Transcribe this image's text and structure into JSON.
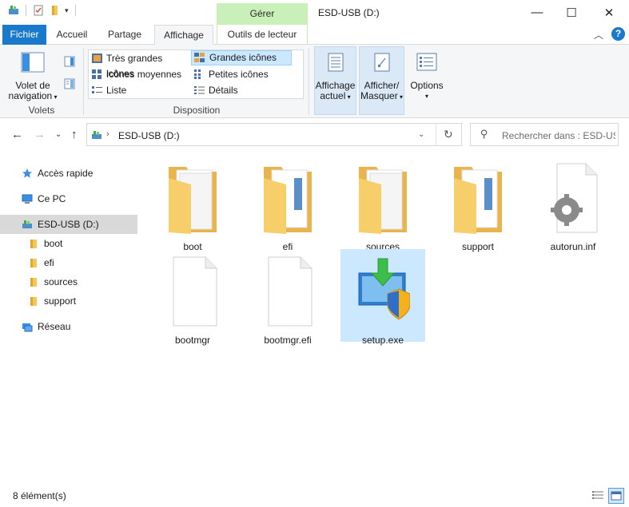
{
  "window": {
    "title": "ESD-USB (D:)",
    "contextual_group": "Gérer",
    "minimize_glyph": "—",
    "maximize_glyph": "☐",
    "close_glyph": "✕"
  },
  "tabs": {
    "file": "Fichier",
    "home": "Accueil",
    "share": "Partage",
    "view": "Affichage",
    "drive_tools": "Outils de lecteur"
  },
  "ribbon": {
    "panes": {
      "nav_pane_line1": "Volet de",
      "nav_pane_line2": "navigation",
      "group": "Volets"
    },
    "layout": {
      "group": "Disposition",
      "extra_large": "Très grandes icônes",
      "large": "Grandes icônes",
      "medium": "Icônes moyennes",
      "small": "Petites icônes",
      "list": "Liste",
      "details": "Détails"
    },
    "current_view_line1": "Affichage",
    "current_view_line2": "actuel",
    "show_hide_line1": "Afficher/",
    "show_hide_line2": "Masquer",
    "options": "Options"
  },
  "address": {
    "path": "ESD-USB (D:)",
    "search_placeholder": "Rechercher dans : ESD-US..."
  },
  "nav_pane": {
    "items": [
      {
        "label": "Accès rapide",
        "icon": "star-icon"
      },
      {
        "label": "Ce PC",
        "icon": "computer-icon"
      },
      {
        "label": "ESD-USB (D:)",
        "icon": "usb-drive-icon",
        "selected": true
      },
      {
        "label": "boot",
        "icon": "folder-icon"
      },
      {
        "label": "efi",
        "icon": "folder-icon"
      },
      {
        "label": "sources",
        "icon": "folder-icon"
      },
      {
        "label": "support",
        "icon": "folder-icon"
      },
      {
        "label": "Réseau",
        "icon": "network-icon"
      }
    ]
  },
  "files": [
    {
      "name": "boot",
      "type": "folder"
    },
    {
      "name": "efi",
      "type": "folder"
    },
    {
      "name": "sources",
      "type": "folder"
    },
    {
      "name": "support",
      "type": "folder"
    },
    {
      "name": "autorun.inf",
      "type": "settings-file"
    },
    {
      "name": "bootmgr",
      "type": "file"
    },
    {
      "name": "bootmgr.efi",
      "type": "file"
    },
    {
      "name": "setup.exe",
      "type": "setup",
      "selected": true
    }
  ],
  "status": {
    "count": "8 élément(s)"
  },
  "colors": {
    "accent": "#1979ca",
    "selection": "#cce8ff",
    "contextual": "#c8f0b8",
    "folder": "#f3c85a"
  }
}
